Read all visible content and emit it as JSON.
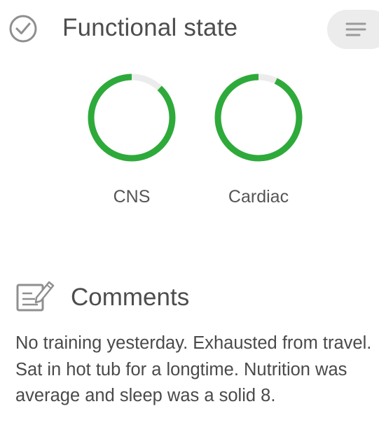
{
  "functional_state": {
    "title": "Functional state",
    "metrics": [
      {
        "label": "CNS",
        "progress": 0.88,
        "color": "#2eaa3a",
        "track_color": "#ececec"
      },
      {
        "label": "Cardiac",
        "progress": 0.93,
        "color": "#2eaa3a",
        "track_color": "#ececec"
      }
    ]
  },
  "comments": {
    "title": "Comments",
    "text": "No training yesterday.  Exhausted from travel.  Sat in hot tub for a longtime. Nutrition was average and sleep was a solid 8."
  },
  "icons": {
    "header": "check-circle-icon",
    "menu": "menu-lines-icon",
    "comments": "comments-edit-icon"
  }
}
